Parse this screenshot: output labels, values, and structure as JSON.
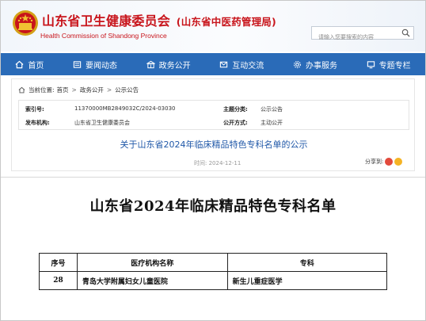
{
  "header": {
    "title": "山东省卫生健康委员会",
    "title_sub": "(山东省中医药管理局)",
    "title_en": "Health Commission of Shandong Province",
    "search_placeholder": "请输入您要搜索的内容",
    "brand_color": "#c8141b"
  },
  "nav": {
    "bg_color": "#2a6bb8",
    "items": [
      {
        "label": "首页",
        "icon": "home-icon"
      },
      {
        "label": "要闻动态",
        "icon": "news-icon"
      },
      {
        "label": "政务公开",
        "icon": "building-icon"
      },
      {
        "label": "互动交流",
        "icon": "mail-icon"
      },
      {
        "label": "办事服务",
        "icon": "gear-icon"
      },
      {
        "label": "专题专栏",
        "icon": "monitor-icon"
      }
    ]
  },
  "breadcrumb": {
    "prefix": "当前位置:",
    "items": [
      "首页",
      "政务公开",
      "公示公告"
    ],
    "separator": ">"
  },
  "meta": {
    "index_label": "索引号:",
    "index_value": "11370000MB2849032C/2024-03030",
    "topic_label": "主题分类:",
    "topic_value": "公示公告",
    "publisher_label": "发布机构:",
    "publisher_value": "山东省卫生健康委员会",
    "disclosure_label": "公开方式:",
    "disclosure_value": "主动公开"
  },
  "article": {
    "title": "关于山东省2024年临床精品特色专科名单的公示",
    "time_label": "时间:",
    "time_value": "2024-12-11",
    "share_label": "分享到:"
  },
  "document": {
    "heading": "山东省2024年临床精品特色专科名单",
    "columns": [
      "序号",
      "医疗机构名称",
      "专科"
    ],
    "rows": [
      [
        "28",
        "青岛大学附属妇女儿童医院",
        "新生儿重症医学"
      ]
    ]
  }
}
